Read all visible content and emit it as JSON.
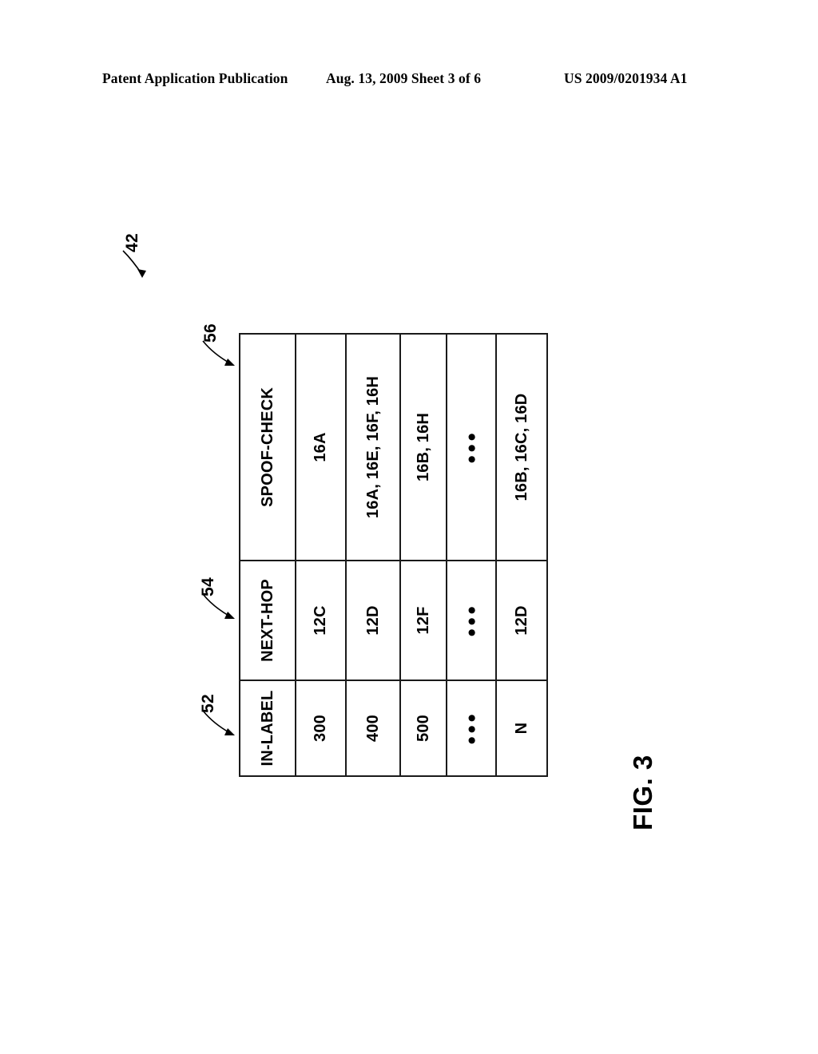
{
  "page_header": {
    "publication": "Patent Application Publication",
    "date_sheet": "Aug. 13, 2009  Sheet 3 of 6",
    "doc_number": "US 2009/0201934 A1"
  },
  "figure": {
    "caption": "FIG. 3",
    "table_ref": "42",
    "column_refs": {
      "in_label": "52",
      "next_hop": "54",
      "spoof_check": "56"
    }
  },
  "table": {
    "headers": [
      "IN-LABEL",
      "NEXT-HOP",
      "SPOOF-CHECK"
    ],
    "rows": [
      {
        "in_label": "300",
        "next_hop": "12C",
        "spoof_check": "16A"
      },
      {
        "in_label": "400",
        "next_hop": "12D",
        "spoof_check": "16A, 16E, 16F, 16H"
      },
      {
        "in_label": "500",
        "next_hop": "12F",
        "spoof_check": "16B, 16H"
      },
      {
        "in_label": "●●●",
        "next_hop": "●●●",
        "spoof_check": "●●●"
      },
      {
        "in_label": "N",
        "next_hop": "12D",
        "spoof_check": "16B, 16C, 16D"
      }
    ]
  },
  "colors": {
    "ink": "#000000",
    "rule": "#1a1a1a",
    "paper": "#ffffff"
  }
}
